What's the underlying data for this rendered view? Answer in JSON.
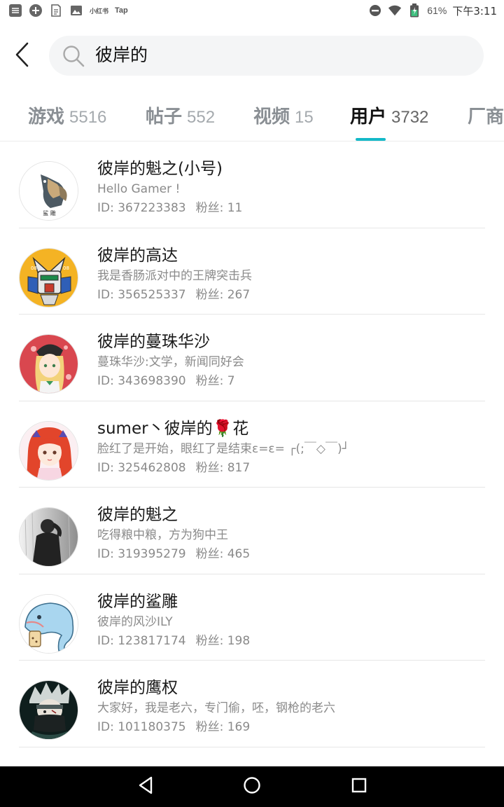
{
  "status_bar": {
    "icons_left": [
      "bank-card-icon",
      "add-circle-icon",
      "document-icon",
      "image-icon"
    ],
    "app_text_1": "小红书",
    "app_text_2": "Tap",
    "battery_percent": "61%",
    "time": "下午3:11"
  },
  "search": {
    "value": "彼岸的"
  },
  "tabs": [
    {
      "label": "游戏",
      "count": "5516"
    },
    {
      "label": "帖子",
      "count": "552"
    },
    {
      "label": "视频",
      "count": "15"
    },
    {
      "label": "用户",
      "count": "3732"
    },
    {
      "label": "厂商",
      "count": ""
    }
  ],
  "active_tab_index": 3,
  "accent_color": "#14b9c8",
  "users": [
    {
      "name": "彼岸的魁之(小号)",
      "bio": "Hello Gamer !",
      "id_text": "ID: 367223383",
      "fans_text": "粉丝: 11"
    },
    {
      "name": "彼岸的高达",
      "bio": "我是香肠派对中的王牌突击兵",
      "id_text": "ID: 356525337",
      "fans_text": "粉丝: 267"
    },
    {
      "name": "彼岸的蔓珠华沙",
      "bio": "蔓珠华沙:文学，新闻同好会",
      "id_text": "ID: 343698390",
      "fans_text": "粉丝: 7"
    },
    {
      "name": "sumer丶彼岸的🌹花",
      "bio": "脸红了是开始，眼红了是结束ε=ε= ┌(;￣◇￣)┘",
      "id_text": "ID: 325462808",
      "fans_text": "粉丝: 817"
    },
    {
      "name": "彼岸的魁之",
      "bio": "吃得粮中粮，方为狗中王",
      "id_text": "ID: 319395279",
      "fans_text": "粉丝: 465"
    },
    {
      "name": "彼岸的鲨雕",
      "bio": "彼岸的风沙ILY",
      "id_text": "ID: 123817174",
      "fans_text": "粉丝: 198"
    },
    {
      "name": "彼岸的鹰权",
      "bio": "大家好，我是老六，专门偷，呸，钢枪的老六",
      "id_text": "ID: 101180375",
      "fans_text": "粉丝: 169"
    }
  ],
  "avatar_labels": {
    "shark": "鲨 雕",
    "gundam_left": "08",
    "gundam_right": "08"
  }
}
